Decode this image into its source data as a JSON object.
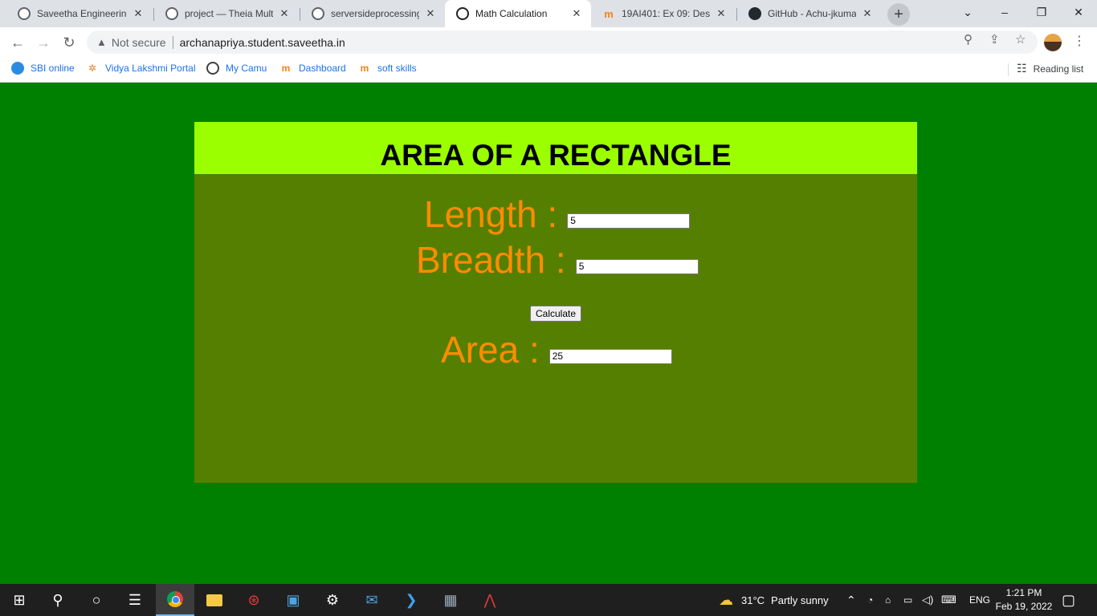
{
  "browser": {
    "tabs": [
      {
        "title": "Saveetha Engineering",
        "icon": "globe-icon",
        "active": false
      },
      {
        "title": "project — Theia Multi",
        "icon": "globe-icon",
        "active": false
      },
      {
        "title": "serversideprocessing",
        "icon": "globe-icon",
        "active": false
      },
      {
        "title": "Math Calculation",
        "icon": "globe-icon",
        "active": true
      },
      {
        "title": "19AI401: Ex 09: Desig",
        "icon": "moodle-icon",
        "active": false
      },
      {
        "title": "GitHub - Achu-jkuma",
        "icon": "github-icon",
        "active": false
      }
    ],
    "close_glyph": "✕",
    "address": {
      "security_label": "Not secure",
      "url": "archanapriya.student.saveetha.in"
    },
    "bookmarks": [
      {
        "label": "SBI online",
        "icon": "sbi-icon"
      },
      {
        "label": "Vidya Lakshmi Portal",
        "icon": "vidya-lakshmi-icon"
      },
      {
        "label": "My Camu",
        "icon": "globe-icon"
      },
      {
        "label": "Dashboard",
        "icon": "moodle-icon"
      },
      {
        "label": "soft skills",
        "icon": "moodle-icon"
      }
    ],
    "reading_list_label": "Reading list"
  },
  "page": {
    "heading": "AREA OF A RECTANGLE",
    "length": {
      "label": "Length :",
      "value": "5"
    },
    "breadth": {
      "label": "Breadth :",
      "value": "5"
    },
    "calculate_label": "Calculate",
    "area": {
      "label": "Area :",
      "value": "25"
    },
    "colors": {
      "background": "#008000",
      "card": "#557f00",
      "header": "#9cff00",
      "label": "#ff8c00"
    }
  },
  "taskbar": {
    "weather": {
      "temp": "31°C",
      "condition": "Partly sunny"
    },
    "language": "ENG",
    "time": "1:21 PM",
    "date": "Feb 19, 2022"
  }
}
